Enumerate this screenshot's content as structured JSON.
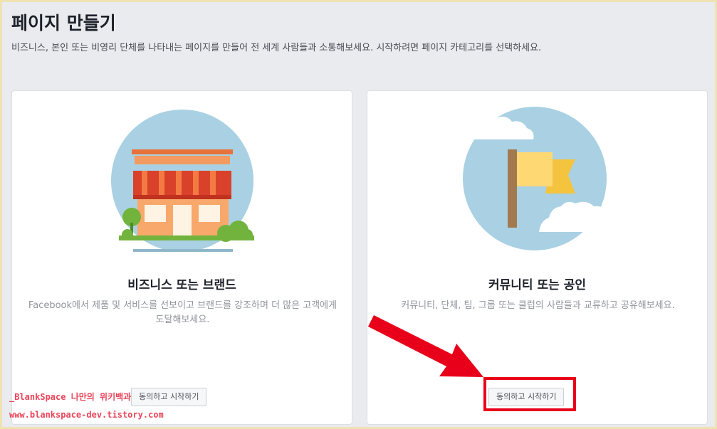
{
  "header": {
    "title": "페이지 만들기",
    "description": "비즈니스, 본인 또는 비영리 단체를 나타내는 페이지를 만들어 전 세계 사람들과 소통해보세요. 시작하려면 페이지 카테고리를 선택하세요."
  },
  "cards": [
    {
      "title": "비즈니스 또는 브랜드",
      "description": "Facebook에서 제품 및 서비스를 선보이고 브랜드를 강조하며 더 많은 고객에게 도달해보세요.",
      "button_label": "동의하고 시작하기",
      "icon": "storefront-icon"
    },
    {
      "title": "커뮤니티 또는 공인",
      "description": "커뮤니티, 단체, 팀, 그룹 또는 클럽의 사람들과 교류하고 공유해보세요.",
      "button_label": "동의하고 시작하기",
      "icon": "flag-icon"
    }
  ],
  "watermark": {
    "line1": "_BlankSpace 나만의 위키백과",
    "line2": "www.blankspace-dev.tistory.com"
  },
  "colors": {
    "background": "#e9ebee",
    "card": "#ffffff",
    "highlight": "#e8001a",
    "illustration_circle": "#a9d1e3"
  }
}
